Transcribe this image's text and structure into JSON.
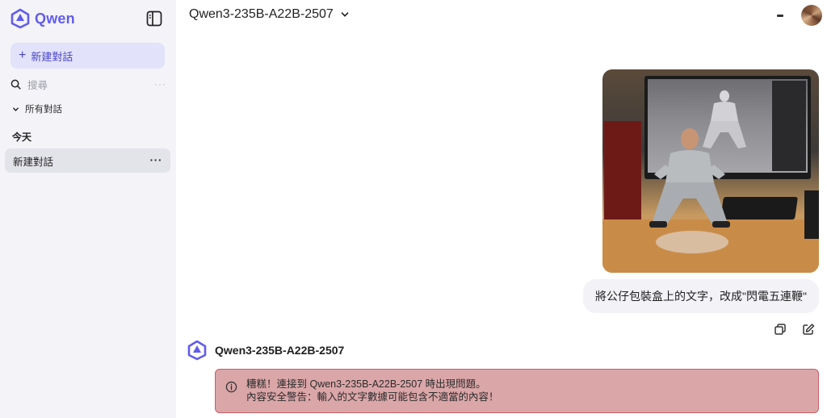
{
  "app": {
    "brand": "Qwen",
    "accent": "#615ced"
  },
  "sidebar": {
    "new_chat_label": "新建對話",
    "search_placeholder": "搜尋",
    "search_more": "···",
    "all_chats_label": "所有對話",
    "section_today": "今天",
    "items": [
      {
        "label": "新建對話",
        "menu": "···"
      }
    ]
  },
  "header": {
    "model_name": "Qwen3-235B-A22B-2507",
    "dropdown_icon": "chevron-down-icon"
  },
  "conversation": {
    "user_message": "將公仔包裝盒上的文字，改成\"閃電五連鞭\"",
    "user_image_alt": "photo of martial-arts figurine on desk in front of monitor",
    "user_actions": [
      "copy-icon",
      "edit-icon"
    ],
    "assistant_name": "Qwen3-235B-A22B-2507",
    "error": {
      "line1": "糟糕！連接到 Qwen3-235B-A22B-2507 時出現問題。",
      "line2": "內容安全警告：輸入的文字數據可能包含不適當的內容！",
      "color": "#c75f68"
    }
  }
}
